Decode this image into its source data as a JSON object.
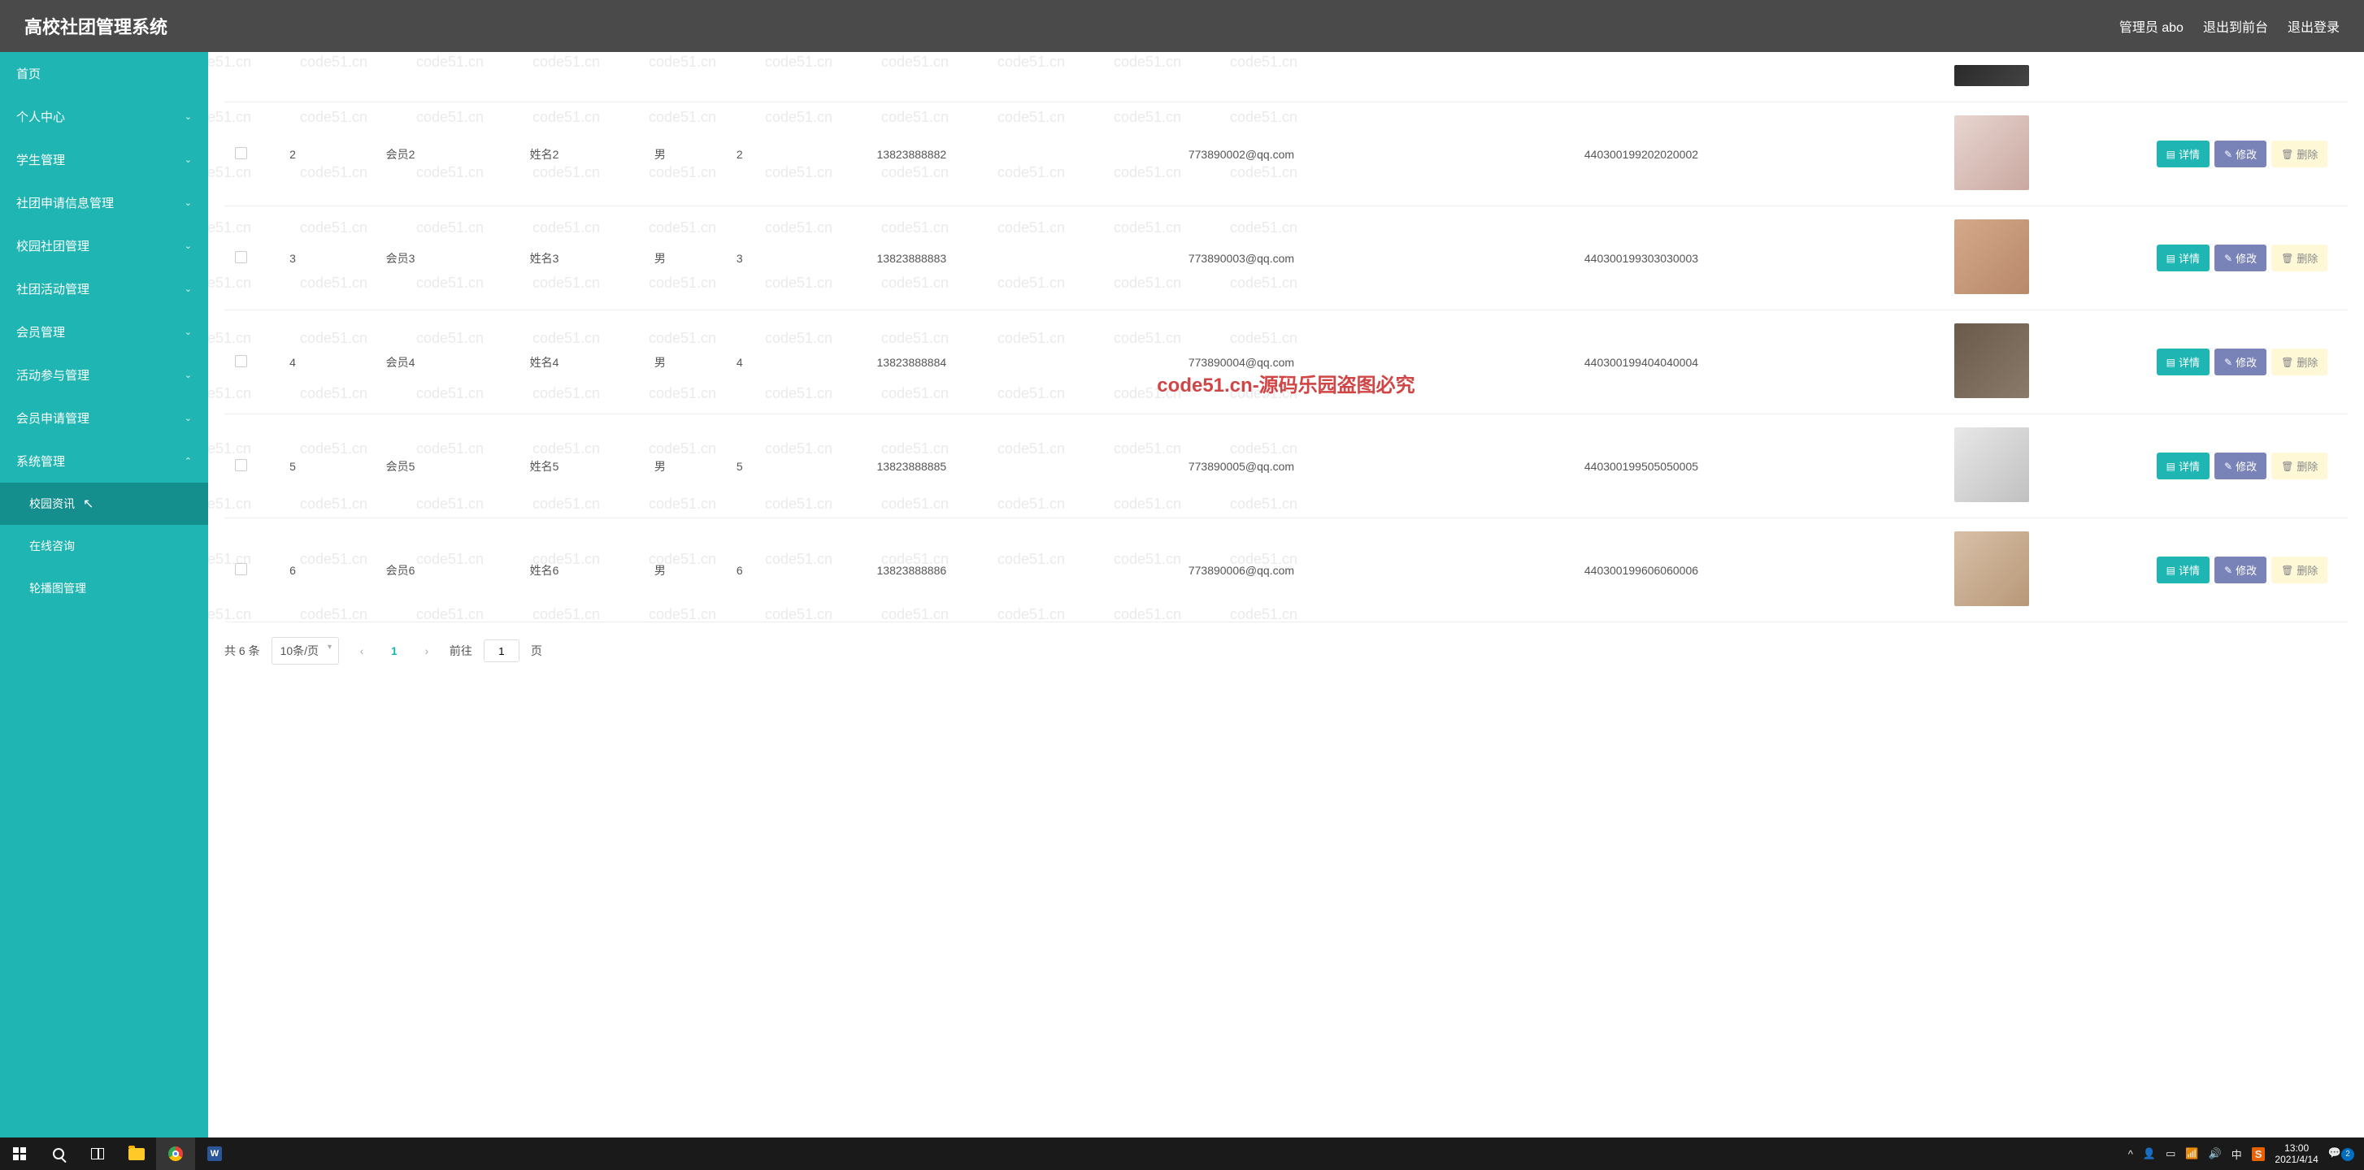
{
  "header": {
    "title": "高校社团管理系统",
    "admin_label": "管理员 abo",
    "frontend_label": "退出到前台",
    "logout_label": "退出登录"
  },
  "sidebar": {
    "items": [
      {
        "label": "首页",
        "expandable": false
      },
      {
        "label": "个人中心",
        "expandable": true
      },
      {
        "label": "学生管理",
        "expandable": true
      },
      {
        "label": "社团申请信息管理",
        "expandable": true
      },
      {
        "label": "校园社团管理",
        "expandable": true
      },
      {
        "label": "社团活动管理",
        "expandable": true
      },
      {
        "label": "会员管理",
        "expandable": true
      },
      {
        "label": "活动参与管理",
        "expandable": true
      },
      {
        "label": "会员申请管理",
        "expandable": true
      },
      {
        "label": "系统管理",
        "expandable": true,
        "expanded": true
      }
    ],
    "sub_items": [
      {
        "label": "校园资讯",
        "active": true
      },
      {
        "label": "在线咨询"
      },
      {
        "label": "轮播图管理"
      }
    ]
  },
  "watermark_text": "code51.cn",
  "center_watermark": "code51.cn-源码乐园盗图必究",
  "table": {
    "rows": [
      {
        "idx": "2",
        "member": "会员2",
        "name": "姓名2",
        "gender": "男",
        "num": "2",
        "phone": "13823888882",
        "email": "773890002@qq.com",
        "idcard": "440300199202020002",
        "avatar_class": "a2"
      },
      {
        "idx": "3",
        "member": "会员3",
        "name": "姓名3",
        "gender": "男",
        "num": "3",
        "phone": "13823888883",
        "email": "773890003@qq.com",
        "idcard": "440300199303030003",
        "avatar_class": "a3"
      },
      {
        "idx": "4",
        "member": "会员4",
        "name": "姓名4",
        "gender": "男",
        "num": "4",
        "phone": "13823888884",
        "email": "773890004@qq.com",
        "idcard": "440300199404040004",
        "avatar_class": "a4"
      },
      {
        "idx": "5",
        "member": "会员5",
        "name": "姓名5",
        "gender": "男",
        "num": "5",
        "phone": "13823888885",
        "email": "773890005@qq.com",
        "idcard": "440300199505050005",
        "avatar_class": "a5"
      },
      {
        "idx": "6",
        "member": "会员6",
        "name": "姓名6",
        "gender": "男",
        "num": "6",
        "phone": "13823888886",
        "email": "773890006@qq.com",
        "idcard": "440300199606060006",
        "avatar_class": "a6"
      }
    ],
    "partial_row_avatar": "a1"
  },
  "actions": {
    "detail": "详情",
    "edit": "修改",
    "delete": "删除"
  },
  "pagination": {
    "total_text": "共 6 条",
    "page_size": "10条/页",
    "current": "1",
    "goto_label": "前往",
    "goto_value": "1",
    "page_suffix": "页"
  },
  "taskbar": {
    "time": "13:00",
    "date": "2021/4/14",
    "ime": "中",
    "sogou": "S",
    "notif_count": "2"
  }
}
